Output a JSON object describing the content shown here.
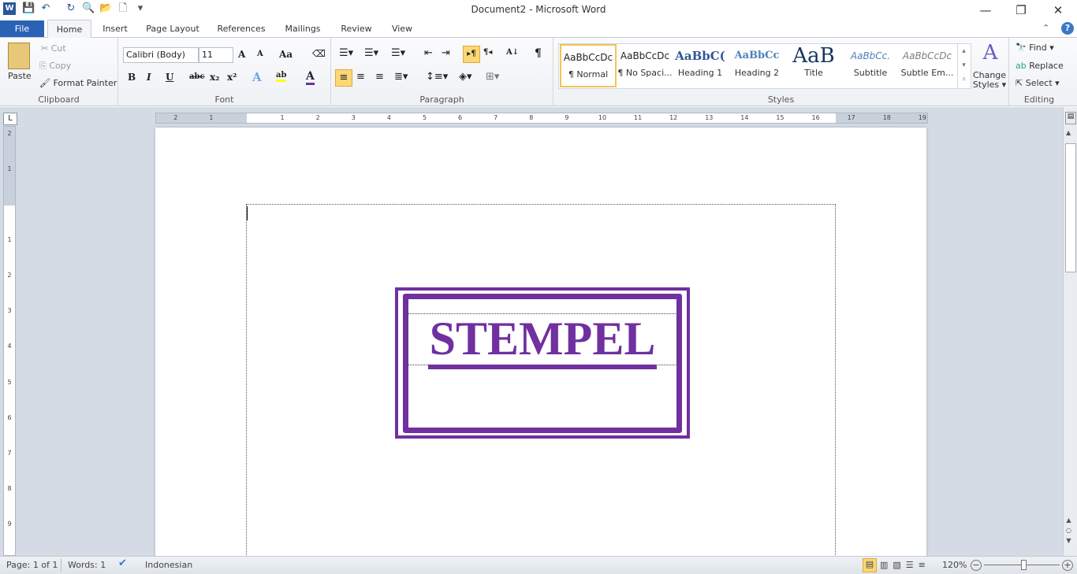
{
  "window": {
    "title": "Document2 - Microsoft Word",
    "minimize": "—",
    "restore": "❐",
    "close": "✕"
  },
  "qat": {
    "word": "W",
    "save": "💾",
    "undo": "↶",
    "redo": "↻",
    "print_preview": "🔍",
    "open": "📂",
    "new": "🗋",
    "customize": "▾"
  },
  "tabs": [
    {
      "label": "File"
    },
    {
      "label": "Home"
    },
    {
      "label": "Insert"
    },
    {
      "label": "Page Layout"
    },
    {
      "label": "References"
    },
    {
      "label": "Mailings"
    },
    {
      "label": "Review"
    },
    {
      "label": "View"
    }
  ],
  "ribbon": {
    "clipboard": {
      "label": "Clipboard",
      "paste": "Paste",
      "cut": "Cut",
      "copy": "Copy",
      "format_painter": "Format Painter"
    },
    "font": {
      "label": "Font",
      "font_name": "Calibri (Body)",
      "font_size": "11",
      "grow": "A",
      "shrink": "A",
      "change_case": "Aa",
      "bold": "B",
      "italic": "I",
      "underline": "U",
      "strike": "abc",
      "subscript": "x₂",
      "superscript": "x²",
      "effects": "A",
      "highlight": "ab",
      "color": "A",
      "font_color": "#7030a0"
    },
    "paragraph": {
      "label": "Paragraph",
      "pilcrow": "¶",
      "ltr": "▸¶",
      "rtl": "¶◂",
      "sort": "A↓"
    },
    "styles": {
      "label": "Styles",
      "items": [
        {
          "preview": "AaBbCcDc",
          "name": "¶ Normal",
          "selected": true
        },
        {
          "preview": "AaBbCcDc",
          "name": "¶ No Spaci..."
        },
        {
          "preview": "AaBbC(",
          "name": "Heading 1"
        },
        {
          "preview": "AaBbCc",
          "name": "Heading 2"
        },
        {
          "preview": "AaB",
          "name": "Title"
        },
        {
          "preview": "AaBbCc.",
          "name": "Subtitle"
        },
        {
          "preview": "AaBbCcDc",
          "name": "Subtle Em..."
        }
      ],
      "change_styles": "Change Styles ▾"
    },
    "editing": {
      "label": "Editing",
      "find": "Find ▾",
      "replace": "Replace",
      "select": "Select ▾"
    }
  },
  "ruler": {
    "left": [
      "2",
      "1"
    ],
    "right": [
      "1",
      "2",
      "3",
      "4",
      "5",
      "6",
      "7",
      "8",
      "9",
      "10",
      "11",
      "12",
      "13",
      "14",
      "15",
      "16",
      "17",
      "18",
      "19"
    ],
    "vertical": [
      "2",
      "1",
      "1",
      "2",
      "3",
      "4",
      "5",
      "6",
      "7",
      "8",
      "9"
    ]
  },
  "document": {
    "stamp_text": "STEMPEL",
    "stamp_color": "#7030a0"
  },
  "status": {
    "page": "Page: 1 of 1",
    "words": "Words: 1",
    "language": "Indonesian",
    "zoom": "120%",
    "zoom_percent": 120
  }
}
